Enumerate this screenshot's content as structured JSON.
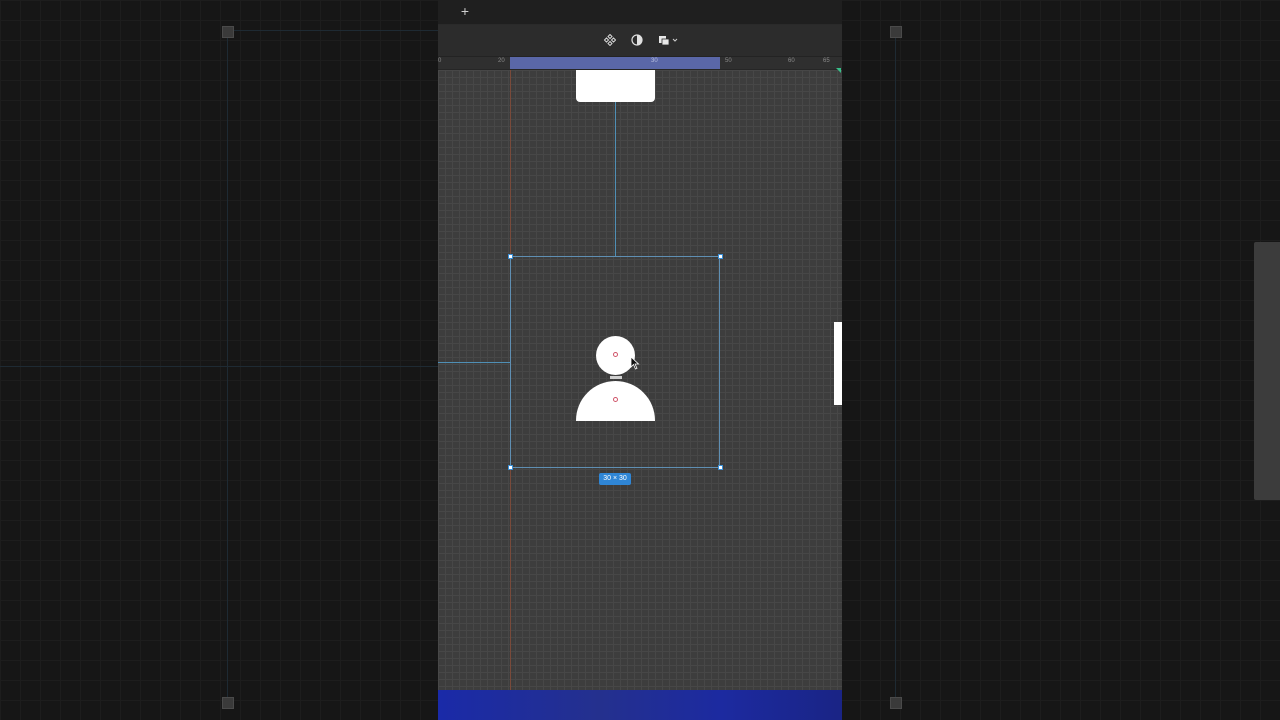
{
  "topbar": {
    "add_label": "+"
  },
  "toolbar": {
    "tools": [
      {
        "name": "component-icon"
      },
      {
        "name": "contrast-icon"
      },
      {
        "name": "boolean-shapes-icon"
      }
    ]
  },
  "ruler": {
    "ticks": [
      "0",
      "20",
      "30",
      "50",
      "60",
      "65"
    ]
  },
  "selection": {
    "size_label": "30 × 30"
  },
  "colors": {
    "selection_accent": "#2f86d6",
    "canvas": "#3d3d3d",
    "bottom_bar": "#1c2aa0"
  }
}
